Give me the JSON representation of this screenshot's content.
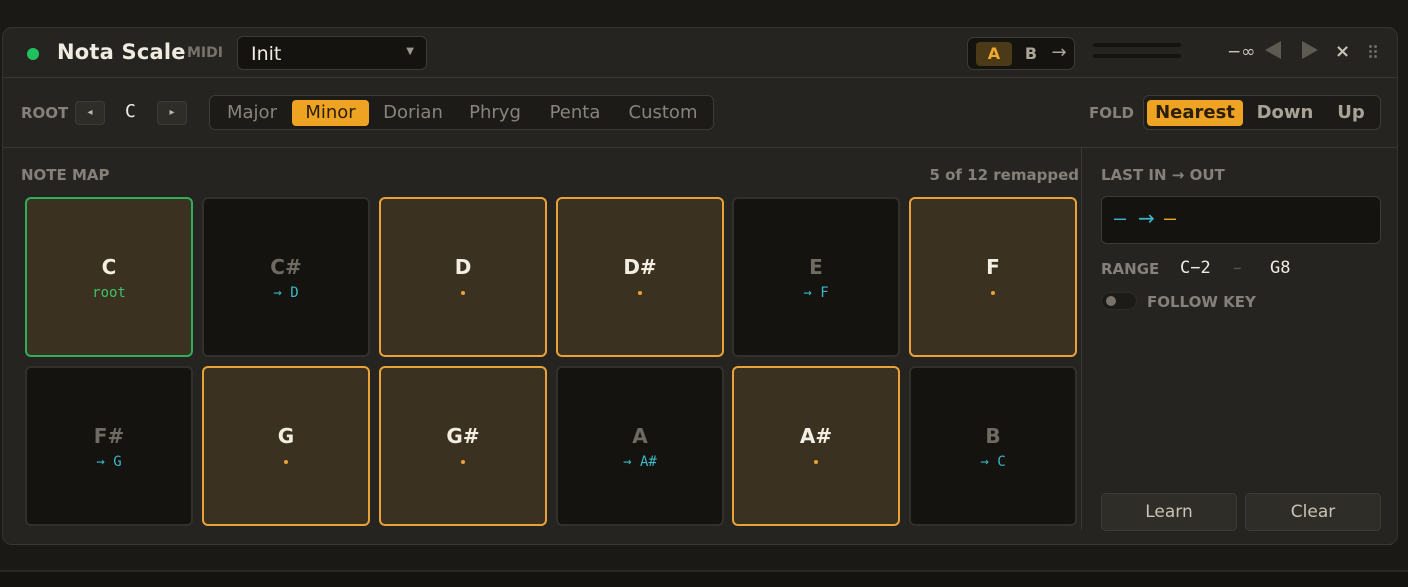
{
  "header": {
    "title": "Nota Scale",
    "type_label": "MIDI",
    "preset": "Init",
    "ab": {
      "a": "A",
      "b": "B",
      "copy": "→"
    },
    "level": "−∞",
    "close": "×"
  },
  "toolbar": {
    "root_label": "ROOT",
    "root_value": "C",
    "root_prev": "◂",
    "root_next": "▸",
    "scales": [
      "Major",
      "Minor",
      "Dorian",
      "Phryg",
      "Penta",
      "Custom"
    ],
    "active_scale": "Minor",
    "fold_label": "FOLD",
    "fold_options": [
      "Nearest",
      "Down",
      "Up"
    ],
    "active_fold": "Nearest"
  },
  "note_map": {
    "label": "NOTE MAP",
    "remap_count": "5 of 12 remapped",
    "notes": [
      {
        "name": "C",
        "state": "root",
        "sub": "root"
      },
      {
        "name": "C#",
        "state": "remapped",
        "sub": "→ D"
      },
      {
        "name": "D",
        "state": "in-scale",
        "sub": ""
      },
      {
        "name": "D#",
        "state": "in-scale",
        "sub": ""
      },
      {
        "name": "E",
        "state": "remapped",
        "sub": "→ F"
      },
      {
        "name": "F",
        "state": "in-scale",
        "sub": ""
      },
      {
        "name": "F#",
        "state": "remapped",
        "sub": "→ G"
      },
      {
        "name": "G",
        "state": "in-scale",
        "sub": ""
      },
      {
        "name": "G#",
        "state": "in-scale",
        "sub": ""
      },
      {
        "name": "A",
        "state": "remapped",
        "sub": "→ A#"
      },
      {
        "name": "A#",
        "state": "in-scale",
        "sub": ""
      },
      {
        "name": "B",
        "state": "remapped",
        "sub": "→ C"
      }
    ]
  },
  "right_panel": {
    "last_label": "LAST IN → OUT",
    "last_in": "—",
    "last_arrow": "→",
    "last_out": "—",
    "range_label": "RANGE",
    "range_low": "C−2",
    "range_sep": "–",
    "range_high": "G8",
    "follow_key_label": "FOLLOW KEY",
    "follow_key_on": false,
    "learn_label": "Learn",
    "clear_label": "Clear"
  },
  "colors": {
    "accent": "#efa323",
    "root": "#2fae5c",
    "remap": "#3bb8c8",
    "power": "#22c160"
  }
}
